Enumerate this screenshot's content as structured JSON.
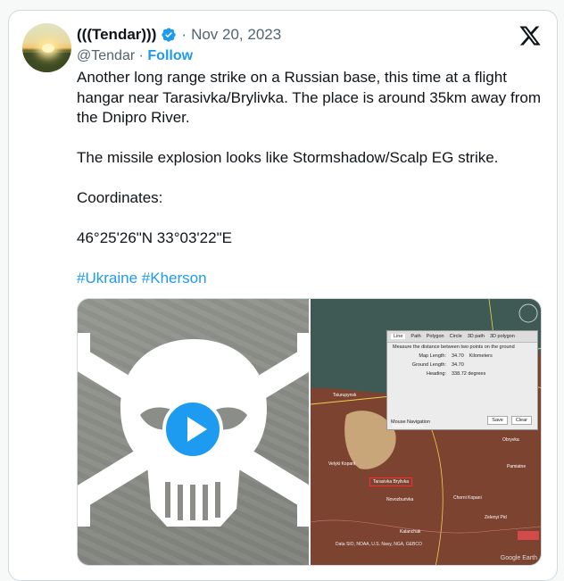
{
  "author": {
    "display_name": "(((Tendar)))",
    "handle": "@Tendar",
    "separator": "·",
    "date": "Nov 20, 2023",
    "follow_label": "Follow"
  },
  "tweet": {
    "para1": "Another long range strike on a Russian base, this time at a flight hangar near Tarasivka/Brylivka. The place is around 35km away from the Dnipro River.",
    "para2": "The missile explosion looks like Stormshadow/Scalp EG strike.",
    "para3": "Coordinates:",
    "para4": "46°25'26\"N 33°03'22\"E",
    "hashtags": [
      "#Ukraine",
      "#Kherson"
    ]
  },
  "icons": {
    "verified": "verified-badge-icon",
    "platform": "x-logo-icon",
    "play": "play-icon"
  },
  "media": {
    "ruler_dialog": {
      "tabs": [
        "Line",
        "Path",
        "Polygon",
        "Circle",
        "3D path",
        "3D polygon"
      ],
      "hint": "Measure the distance between two points on the ground",
      "rows": [
        {
          "k": "Map Length:",
          "v": "34.70",
          "unit": "Kilometers"
        },
        {
          "k": "Ground Length:",
          "v": "34.70",
          "unit": ""
        },
        {
          "k": "Heading:",
          "v": "338.72 degrees",
          "unit": ""
        }
      ],
      "mouse_nav": "Mouse Navigation",
      "save": "Save",
      "clear": "Clear"
    },
    "map_labels": {
      "l1": "Nova Maiachka",
      "l2": "Velyki Kopani",
      "l3": "Tarasivka Brylivka",
      "l4": "Chorni Kopani",
      "l5": "Novozburivka",
      "l6": "Tsiurupynsk",
      "l7": "Obryvka",
      "l8": "Pamiatne",
      "l9": "Zelenyi Pid",
      "l10": "Kalanchak"
    },
    "attribution": "Data SIO, NOAA, U.S. Navy, NGA, GEBCO",
    "google_logo": "Google Earth"
  },
  "colors": {
    "accent": "#1d9bf0",
    "text": "#0f1419",
    "muted": "#536471",
    "border": "#cfd9de"
  }
}
